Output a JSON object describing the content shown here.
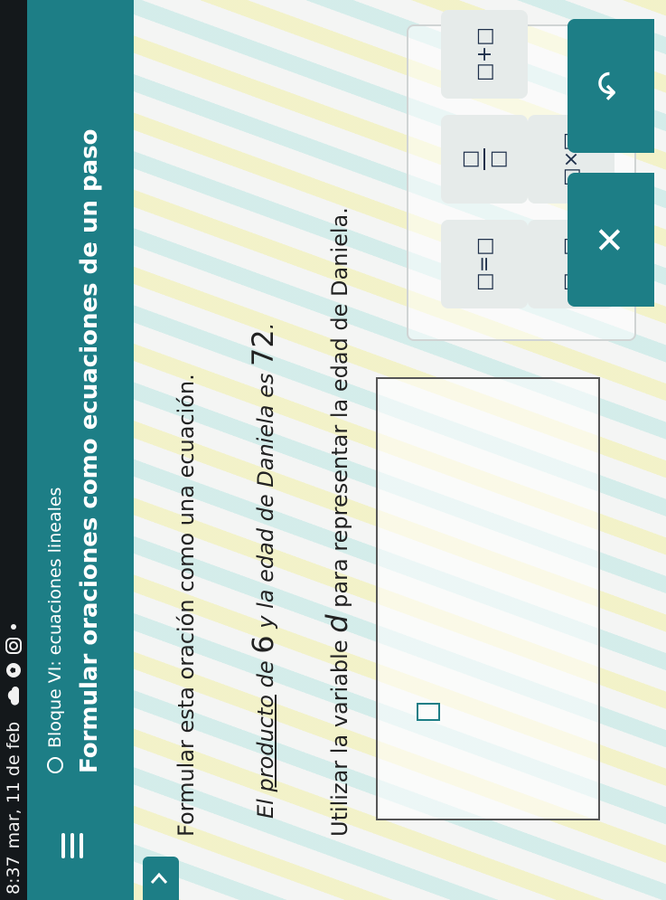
{
  "status_bar": {
    "time": "8:37",
    "date": "mar, 11 de feb",
    "icons": [
      "cloud-icon",
      "soccer-ball-icon",
      "instagram-icon",
      "notification-dot-icon"
    ]
  },
  "header": {
    "topic": "Bloque VI: ecuaciones lineales",
    "title": "Formular oraciones como ecuaciones de un paso",
    "menu_icon": "hamburger-menu-icon"
  },
  "problem": {
    "instruction": "Formular esta oración como una ecuación.",
    "sentence_prefix": "El ",
    "sentence_underlined": "producto",
    "sentence_mid": " de ",
    "number_one": "6",
    "sentence_mid2": " y la edad de Daniela es ",
    "number_two": "72",
    "sentence_suffix": ".",
    "variable_prefix": "Utilizar la variable ",
    "variable": "d",
    "variable_suffix": " para representar la edad de Daniela."
  },
  "keypad": {
    "keys": [
      "□=□",
      "□/□",
      "□+□",
      "□−□",
      "□×□"
    ]
  },
  "actions": {
    "clear_label": "✕",
    "undo_label": "↶"
  },
  "colors": {
    "accent": "#1d7e86",
    "key_bg": "#e6ebea",
    "text": "#222222"
  }
}
